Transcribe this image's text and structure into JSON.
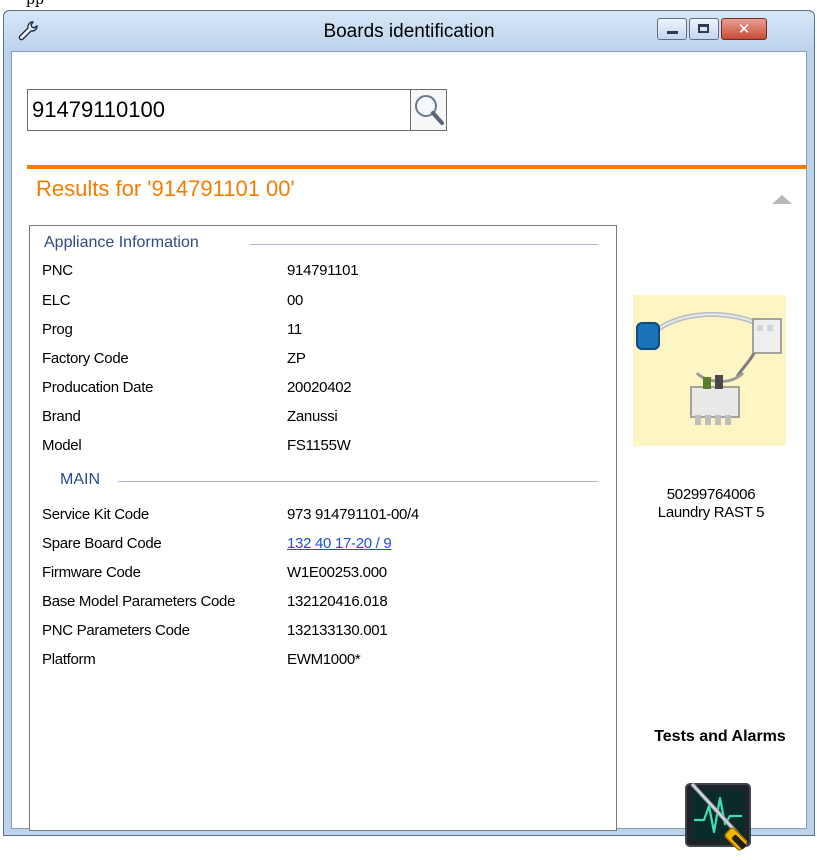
{
  "window": {
    "title": "Boards identification",
    "above_text": "pp",
    "close_glyph": "✕"
  },
  "search": {
    "value": "91479110100"
  },
  "results": {
    "title": "Results for '914791101 00'"
  },
  "appliance_information": {
    "header": "Appliance Information",
    "rows": [
      {
        "label": "PNC",
        "value": "914791101"
      },
      {
        "label": "ELC",
        "value": "00"
      },
      {
        "label": "Prog",
        "value": "11"
      },
      {
        "label": "Factory Code",
        "value": "ZP"
      },
      {
        "label": "Producation Date",
        "value": "20020402"
      },
      {
        "label": "Brand",
        "value": "Zanussi"
      },
      {
        "label": "Model",
        "value": "FS1155W"
      }
    ]
  },
  "main": {
    "header": "MAIN",
    "rows": [
      {
        "label": "Service Kit Code",
        "value": "973 914791101-00/4"
      },
      {
        "label": "Spare Board Code",
        "value": "132 40 17-20 / 9"
      },
      {
        "label": "Firmware Code",
        "value": "W1E00253.000"
      },
      {
        "label": "Base Model Parameters Code",
        "value": "132120416.018"
      },
      {
        "label": "PNC Parameters Code",
        "value": "132133130.001"
      },
      {
        "label": "Platform",
        "value": "EWM1000*"
      }
    ]
  },
  "board": {
    "code": "50299764006",
    "name": "Laundry  RAST 5"
  },
  "tests": {
    "label": "Tests and Alarms"
  },
  "colors": {
    "accent": "#f47c00",
    "group_header": "#2a4b8c",
    "link": "#1a4fd6",
    "titlebar": "#bcd3ec"
  },
  "icons": [
    "wrench-icon",
    "minimize-icon",
    "maximize-icon",
    "close-icon",
    "search-icon",
    "collapse-arrow-icon",
    "board-image",
    "tests-alarms-icon"
  ]
}
